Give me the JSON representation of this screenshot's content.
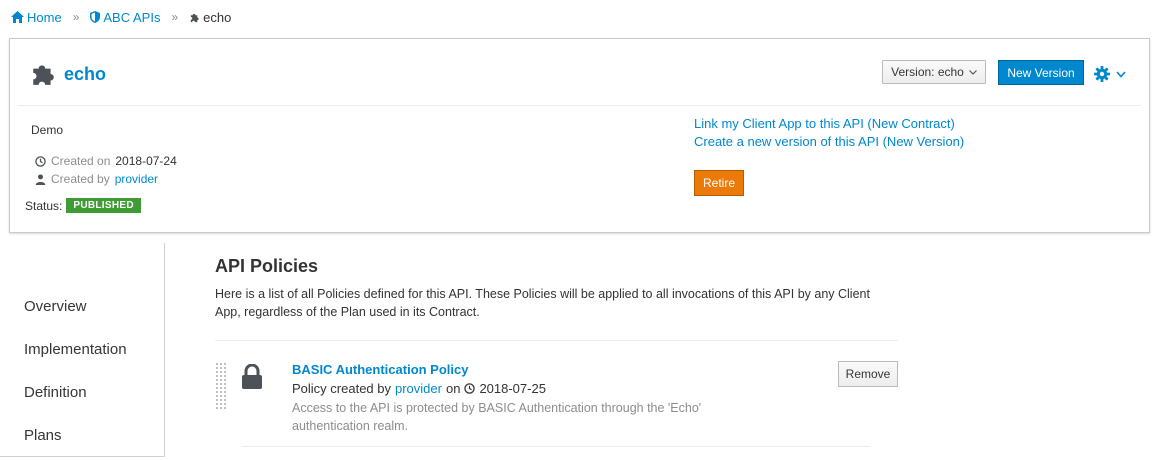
{
  "breadcrumb": {
    "home": "Home",
    "org": "ABC APIs",
    "current": "echo"
  },
  "api": {
    "name": "echo",
    "description": "Demo",
    "created_on_label": "Created on",
    "created_on": "2018-07-24",
    "created_by_label": "Created by",
    "created_by": "provider",
    "status_label": "Status:",
    "status": "PUBLISHED"
  },
  "toolbar": {
    "version_label": "Version: echo",
    "new_version_label": "New Version"
  },
  "actions": {
    "link_client_app": "Link my Client App to this API (New Contract)",
    "create_new_version": "Create a new version of this API (New Version)",
    "retire_label": "Retire"
  },
  "sidenav": {
    "items": [
      {
        "label": "Overview"
      },
      {
        "label": "Implementation"
      },
      {
        "label": "Definition"
      },
      {
        "label": "Plans"
      }
    ]
  },
  "main": {
    "title": "API Policies",
    "description": "Here is a list of all Policies defined for this API. These Policies will be applied to all invocations of this API by any Client App, regardless of the Plan used in its Contract."
  },
  "policies": [
    {
      "name": "BASIC Authentication Policy",
      "created_by_prefix": "Policy created by",
      "created_by": "provider",
      "on_label": "on",
      "date": "2018-07-25",
      "description": "Access to the API is protected by BASIC Authentication through the 'Echo' authentication realm.",
      "remove_label": "Remove"
    }
  ],
  "colors": {
    "link": "#0088ce",
    "primary_button": "#0088ce",
    "retire_button": "#ec7a08",
    "published_badge": "#3f9c35",
    "icon_dark": "#4d5258"
  },
  "icons": {
    "home": "home-icon",
    "org": "shield-icon",
    "api": "puzzle-icon",
    "settings": "gear-icon",
    "created_on": "clock-icon",
    "created_by": "user-icon",
    "policy": "lock-icon"
  }
}
